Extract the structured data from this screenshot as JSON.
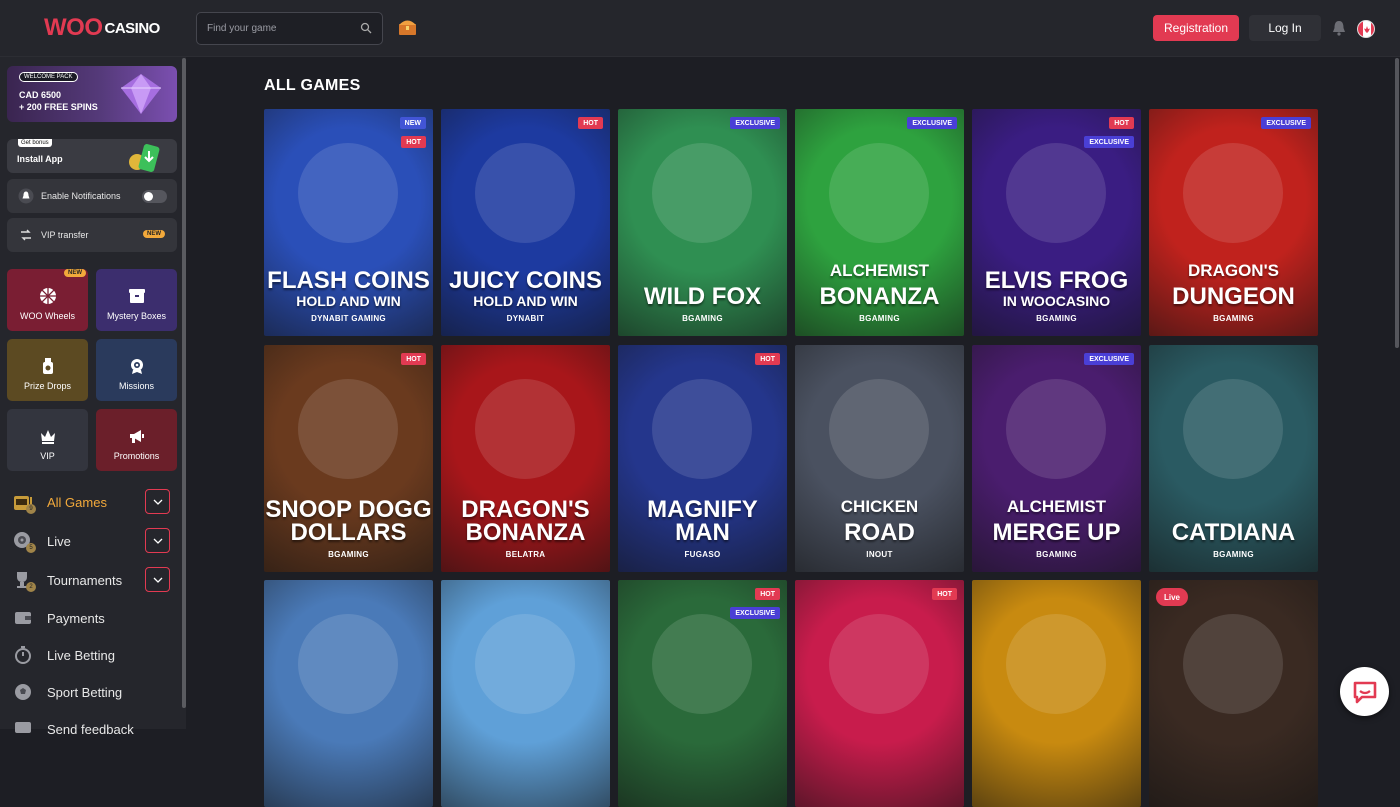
{
  "header": {
    "logo_woo": "WOO",
    "logo_casino": "CASINO",
    "search_placeholder": "Find your game",
    "registration_label": "Registration",
    "login_label": "Log In"
  },
  "sidebar": {
    "promo": {
      "tag": "WELCOME PACK",
      "line1": "CAD 6500",
      "line2": "+ 200 FREE SPINS"
    },
    "install": {
      "badge": "Get bonus",
      "label": "Install App"
    },
    "notifications_label": "Enable Notifications",
    "vip_transfer": {
      "label": "VIP transfer",
      "badge": "NEW"
    },
    "tiles": [
      {
        "label": "WOO Wheels",
        "badge": "NEW",
        "icon": "wheel-icon"
      },
      {
        "label": "Mystery Boxes",
        "icon": "box-icon"
      },
      {
        "label": "Prize Drops",
        "icon": "prize-drop-icon"
      },
      {
        "label": "Missions",
        "icon": "missions-icon"
      },
      {
        "label": "VIP",
        "icon": "crown-icon"
      },
      {
        "label": "Promotions",
        "icon": "megaphone-icon"
      }
    ],
    "nav": [
      {
        "label": "All Games",
        "badge": "9",
        "active": true,
        "expandable": true
      },
      {
        "label": "Live",
        "badge": "5",
        "expandable": true
      },
      {
        "label": "Tournaments",
        "badge": "2",
        "expandable": true
      },
      {
        "label": "Payments"
      },
      {
        "label": "Live Betting"
      },
      {
        "label": "Sport Betting"
      },
      {
        "label": "Send feedback"
      }
    ]
  },
  "main": {
    "title": "ALL GAMES",
    "games": [
      {
        "name1": "FLASH COINS",
        "name2": "HOLD AND WIN",
        "provider": "DYNABIT GAMING",
        "badges": [
          "NEW",
          "HOT"
        ],
        "color": "#2a4fb8"
      },
      {
        "name1": "JUICY COINS",
        "name2": "HOLD AND WIN",
        "provider": "DYNABIT",
        "badges": [
          "HOT"
        ],
        "color": "#1d3aa0"
      },
      {
        "name1": "WILD FOX",
        "name2": "",
        "provider": "BGAMING",
        "badges": [
          "EXCLUSIVE"
        ],
        "color": "#2f8f52"
      },
      {
        "name1": "ALCHEMIST",
        "name2": "BONANZA",
        "provider": "BGAMING",
        "badges": [
          "EXCLUSIVE"
        ],
        "color": "#2ea23f"
      },
      {
        "name1": "ELVIS FROG",
        "name2": "IN WOOCASINO",
        "provider": "BGAMING",
        "badges": [
          "HOT",
          "EXCLUSIVE"
        ],
        "color": "#3a1d82"
      },
      {
        "name1": "DRAGON'S",
        "name2": "DUNGEON",
        "provider": "BGAMING",
        "badges": [
          "EXCLUSIVE"
        ],
        "color": "#c0221d"
      },
      {
        "name1": "SNOOP DOGG",
        "name2": "DOLLARS",
        "provider": "BGAMING",
        "badges": [
          "HOT"
        ],
        "color": "#6a3a1e"
      },
      {
        "name1": "DRAGON'S",
        "name2": "BONANZA",
        "provider": "BELATRA",
        "badges": [],
        "color": "#a8161a"
      },
      {
        "name1": "MAGNIFY",
        "name2": "MAN",
        "provider": "FUGASO",
        "badges": [
          "HOT"
        ],
        "color": "#24368c"
      },
      {
        "name1": "CHICKEN",
        "name2": "ROAD",
        "provider": "INOUT",
        "badges": [],
        "color": "#4a5160"
      },
      {
        "name1": "ALCHEMIST",
        "name2": "MERGE UP",
        "provider": "BGAMING",
        "badges": [
          "EXCLUSIVE"
        ],
        "color": "#4a1d6e"
      },
      {
        "name1": "CATDIANA",
        "name2": "",
        "provider": "BGAMING",
        "badges": [],
        "color": "#2a5a62"
      },
      {
        "name1": "",
        "name2": "",
        "provider": "",
        "badges": [],
        "color": "#4a7ab8"
      },
      {
        "name1": "",
        "name2": "",
        "provider": "",
        "badges": [],
        "color": "#5fa0d8"
      },
      {
        "name1": "",
        "name2": "",
        "provider": "",
        "badges": [
          "HOT",
          "EXCLUSIVE"
        ],
        "color": "#2a6a3a"
      },
      {
        "name1": "",
        "name2": "",
        "provider": "",
        "badges": [
          "HOT"
        ],
        "color": "#c81c4c"
      },
      {
        "name1": "",
        "name2": "",
        "provider": "",
        "badges": [],
        "color": "#c88a10"
      },
      {
        "name1": "",
        "name2": "",
        "provider": "",
        "badges": [
          "Live"
        ],
        "color": "#3a2a22"
      }
    ]
  },
  "colors": {
    "accent": "#e23a52",
    "gold": "#f2a93b",
    "sidebar_bg": "#25262c",
    "page_bg": "#1d1e24"
  }
}
